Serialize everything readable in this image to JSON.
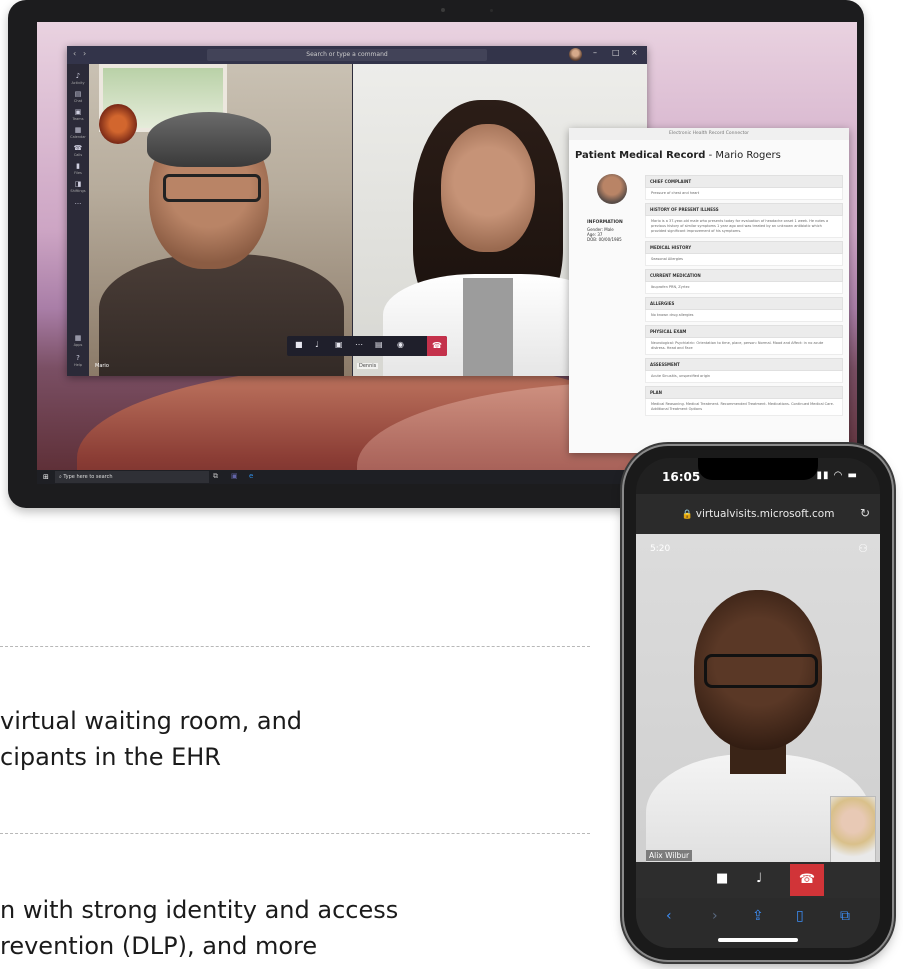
{
  "laptop": {
    "teams": {
      "command_placeholder": "Search or type a command",
      "rail": [
        "Activity",
        "Chat",
        "Teams",
        "Calendar",
        "Calls",
        "Files",
        "Shiftings",
        "..."
      ],
      "rail_bottom": [
        "Apps",
        "Help"
      ],
      "participant_left": "Mario",
      "participant_right": "Dennis"
    },
    "ehr": {
      "window_title": "Electronic Health Record Connector",
      "title_bold": "Patient Medical Record",
      "title_rest": " - Mario Rogers",
      "info_heading": "INFORMATION",
      "info_lines": [
        "Gender: Male",
        "Age: 37",
        "DOB: 00/00/1985"
      ],
      "sections": [
        {
          "heading": "CHIEF COMPLAINT",
          "body": "Pressure of chest and heart"
        },
        {
          "heading": "HISTORY OF PRESENT ILLNESS",
          "body": "Mario is a 37-year-old male who presents today for evaluation of headache onset 1 week. He notes a previous history of similar symptoms 1 year ago and was treated by an unknown antibiotic which provided significant improvement of his symptoms."
        },
        {
          "heading": "MEDICAL HISTORY",
          "body": "Seasonal Allergies"
        },
        {
          "heading": "CURRENT MEDICATION",
          "body": "Ibuprofen PRN, Zyrtec"
        },
        {
          "heading": "ALLERGIES",
          "body": "No known drug allergies"
        },
        {
          "heading": "PHYSICAL EXAM",
          "body": "Neurological: Psychiatric: Orientation to time, place, person: Normal. Mood and Affect: in no acute distress. Head and Face"
        },
        {
          "heading": "ASSESSMENT",
          "body": "Acute Sinusitis, unspecified origin"
        },
        {
          "heading": "PLAN",
          "body": "Medical Reasoning. Medical Treatment. Recommended Treatment. Medications. Continued Medical Care. Additional Treatment Options"
        }
      ]
    },
    "taskbar": {
      "search_placeholder": "Type here to search"
    }
  },
  "text": {
    "para1_line1": "virtual waiting room, and",
    "para1_line2": "cipants in the EHR",
    "para2_line1": "n with strong identity and access",
    "para2_line2": "revention (DLP), and more"
  },
  "phone": {
    "time": "16:05",
    "url": "virtualvisits.microsoft.com",
    "call_timer": "5:20",
    "participant_name": "Alix Wilbur"
  }
}
